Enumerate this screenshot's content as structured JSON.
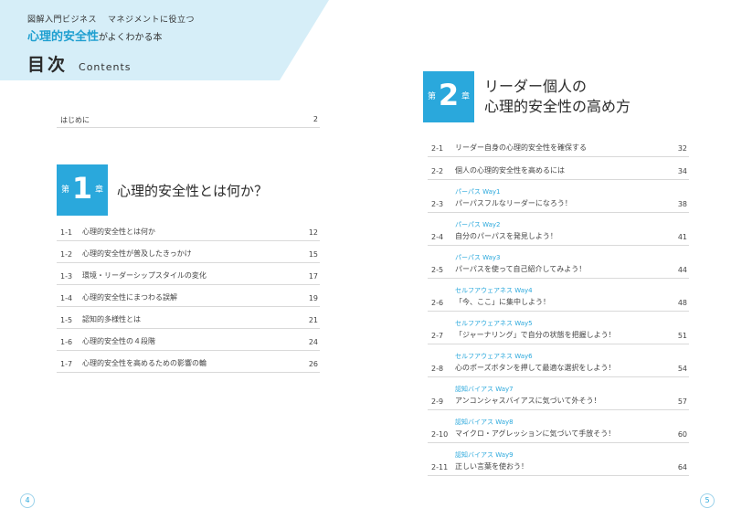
{
  "left_header": {
    "series": "図解入門ビジネス",
    "series2": "マネジメントに役立つ",
    "book_title_main": "心理的安全性",
    "book_title_rest": "がよくわかる本",
    "toc_title": "目次",
    "toc_title_en": "Contents"
  },
  "intro": {
    "label": "はじめに",
    "page": "2"
  },
  "chapter1": {
    "dai": "第",
    "number": "1",
    "sho": "章",
    "title": "心理的安全性とは何か？",
    "items": [
      {
        "no": "1-1",
        "text": "心理的安全性とは何か",
        "page": "12"
      },
      {
        "no": "1-2",
        "text": "心理的安全性が普及したきっかけ",
        "page": "15"
      },
      {
        "no": "1-3",
        "text": "環境・リーダーシップスタイルの変化",
        "page": "17"
      },
      {
        "no": "1-4",
        "text": "心理的安全性にまつわる誤解",
        "page": "19"
      },
      {
        "no": "1-5",
        "text": "認知的多様性とは",
        "page": "21"
      },
      {
        "no": "1-6",
        "text": "心理的安全性の４段階",
        "page": "24"
      },
      {
        "no": "1-7",
        "text": "心理的安全性を高めるための影響の輪",
        "page": "26"
      }
    ]
  },
  "chapter2": {
    "dai": "第",
    "number": "2",
    "sho": "章",
    "title_line1": "リーダー個人の",
    "title_line2": "心理的安全性の高め方",
    "items": [
      {
        "no": "2-1",
        "way": "",
        "text": "リーダー自身の心理的安全性を確保する",
        "page": "32"
      },
      {
        "no": "2-2",
        "way": "",
        "text": "個人の心理的安全性を高めるには",
        "page": "34"
      },
      {
        "no": "2-3",
        "way": "パーパス Way1",
        "text": "パーパスフルなリーダーになろう！",
        "page": "38"
      },
      {
        "no": "2-4",
        "way": "パーパス Way2",
        "text": "自分のパーパスを発見しよう！",
        "page": "41"
      },
      {
        "no": "2-5",
        "way": "パーパス Way3",
        "text": "パーパスを使って自己紹介してみよう！",
        "page": "44"
      },
      {
        "no": "2-6",
        "way": "セルフアウェアネス Way4",
        "text": "「今、ここ」に集中しよう！",
        "page": "48"
      },
      {
        "no": "2-7",
        "way": "セルフアウェアネス Way5",
        "text": "「ジャーナリング」で自分の状態を把握しよう！",
        "page": "51"
      },
      {
        "no": "2-8",
        "way": "セルフアウェアネス Way6",
        "text": "心のポーズボタンを押して最適な選択をしよう！",
        "page": "54"
      },
      {
        "no": "2-9",
        "way": "認知バイアス Way7",
        "text": "アンコンシャスバイアスに気づいて外そう！",
        "page": "57"
      },
      {
        "no": "2-10",
        "way": "認知バイアス Way8",
        "text": "マイクロ・アグレッションに気づいて手放そう！",
        "page": "60"
      },
      {
        "no": "2-11",
        "way": "認知バイアス Way9",
        "text": "正しい言葉を使おう！",
        "page": "64"
      }
    ]
  },
  "page_numbers": {
    "left": "4",
    "right": "5"
  },
  "colors": {
    "accent": "#2aa8dc",
    "header_band": "#d6eef8"
  }
}
